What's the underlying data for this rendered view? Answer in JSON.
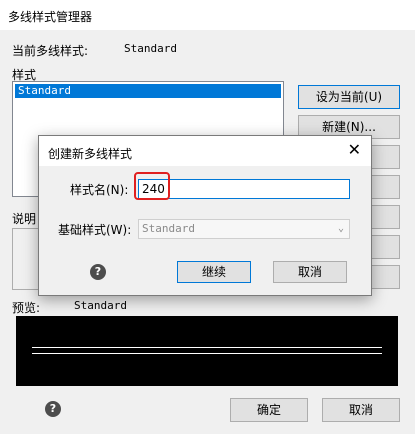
{
  "main": {
    "title": "多线样式管理器",
    "current_label": "当前多线样式:",
    "current_value": "Standard",
    "styles_label": "样式",
    "styles": [
      "Standard"
    ],
    "desc_label": "说明",
    "preview_label": "预览:",
    "preview_value": "Standard",
    "buttons": {
      "set_current": "设为当前(U)",
      "new": "新建(N)..."
    },
    "ok": "确定",
    "cancel": "取消"
  },
  "dialog": {
    "title": "创建新多线样式",
    "name_label": "样式名(N):",
    "name_value": "240",
    "base_label": "基础样式(W):",
    "base_value": "Standard",
    "continue": "继续",
    "cancel": "取消"
  },
  "icons": {
    "help": "help-icon",
    "close": "close-icon",
    "dropdown": "chevron-down-icon"
  },
  "colors": {
    "selection": "#0078d7",
    "highlight": "#e02020"
  }
}
